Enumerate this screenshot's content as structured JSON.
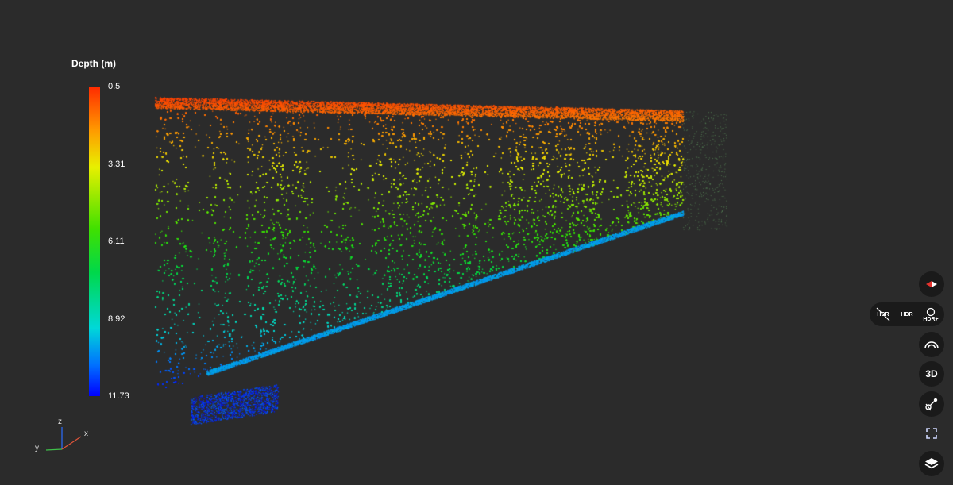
{
  "legend": {
    "title": "Depth (m)",
    "ticks": [
      "0.5",
      "3.31",
      "6.11",
      "8.92",
      "11.73"
    ]
  },
  "axes": {
    "x": "x",
    "y": "y",
    "z": "z"
  },
  "toolbar": {
    "hdr_off_label": "HDR",
    "hdr_label": "HDR",
    "hdr_plus_label": "HDR+",
    "view3d_label": "3D"
  },
  "colors": {
    "background": "#2b2b2b",
    "button": "#1a1a1a",
    "compass_accent": "#e5322d"
  },
  "icons": {
    "compass": "compass-icon",
    "dome": "dome-icon",
    "measure": "measure-icon",
    "fullscreen": "fullscreen-icon",
    "layers": "layers-icon"
  }
}
